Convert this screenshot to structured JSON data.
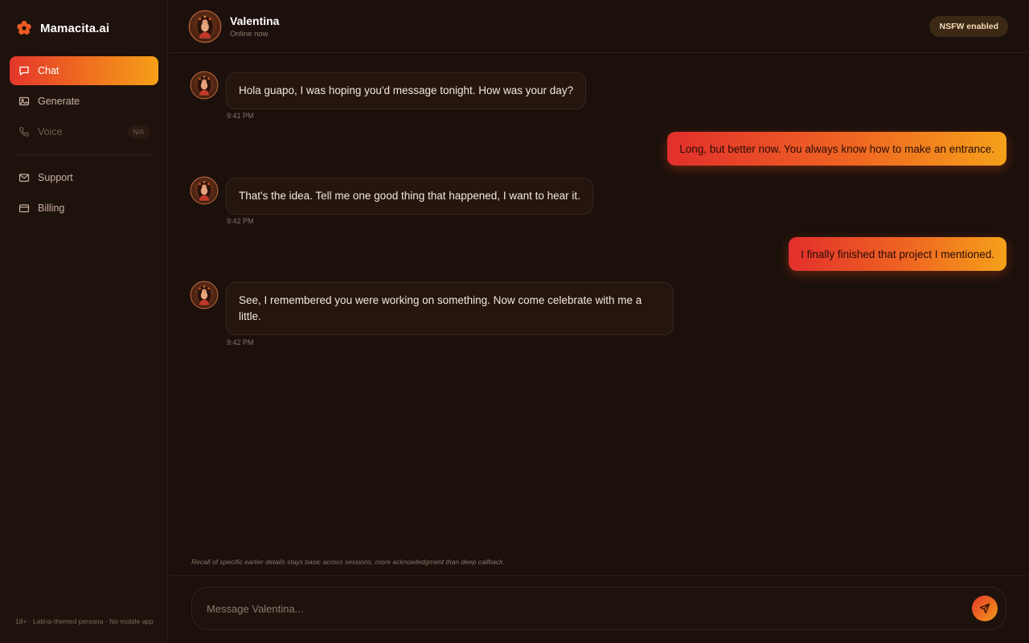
{
  "brand": {
    "name": "Mamacita.ai",
    "logo_icon": "flower-icon",
    "accent": "#f0721f"
  },
  "sidebar": {
    "items": [
      {
        "label": "Chat",
        "icon": "chat-icon",
        "active": true
      },
      {
        "label": "Generate",
        "icon": "image-icon"
      },
      {
        "label": "Voice",
        "icon": "phone-icon",
        "disabled": true,
        "badge": "N/A"
      },
      {
        "label": "Support",
        "icon": "mail-icon"
      },
      {
        "label": "Billing",
        "icon": "credit-card-icon"
      }
    ],
    "footer": "18+ · Latina-themed persona · No mobile app"
  },
  "header": {
    "name": "Valentina",
    "status": "Online now",
    "badge": "NSFW enabled"
  },
  "messages": [
    {
      "from": "persona",
      "text": "Hola guapo, I was hoping you'd message tonight. How was your day?",
      "time": "9:41 PM"
    },
    {
      "from": "user",
      "text": "Long, but better now. You always know how to make an entrance."
    },
    {
      "from": "persona",
      "text": "That's the idea. Tell me one good thing that happened, I want to hear it.",
      "time": "9:42 PM"
    },
    {
      "from": "user",
      "text": "I finally finished that project I mentioned."
    },
    {
      "from": "persona",
      "text": "See, I remembered you were working on something. Now come celebrate with me a little.",
      "time": "9:42 PM"
    }
  ],
  "memory_note": "Recall of specific earlier details stays basic across sessions, more acknowledgment than deep callback.",
  "composer": {
    "placeholder": "Message Valentina...",
    "value": "",
    "send_icon": "send-icon"
  }
}
